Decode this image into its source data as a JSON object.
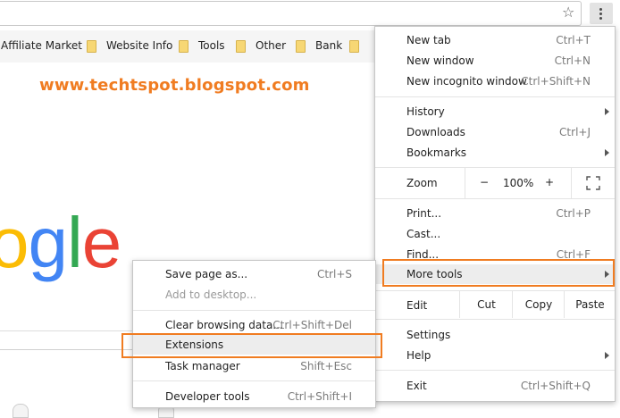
{
  "bookmarks": [
    {
      "label": "Affiliate Market"
    },
    {
      "label": "Website Info"
    },
    {
      "label": "Tools"
    },
    {
      "label": "Other"
    },
    {
      "label": "Bank"
    }
  ],
  "page": {
    "site_url": "www.techtspot.blogspot.com",
    "logo_letters": [
      "o",
      "g",
      "l",
      "e"
    ]
  },
  "main_menu": {
    "new_tab": {
      "label": "New tab",
      "shortcut": "Ctrl+T"
    },
    "new_window": {
      "label": "New window",
      "shortcut": "Ctrl+N"
    },
    "new_incognito": {
      "label": "New incognito window",
      "shortcut": "Ctrl+Shift+N"
    },
    "history": {
      "label": "History"
    },
    "downloads": {
      "label": "Downloads",
      "shortcut": "Ctrl+J"
    },
    "bookmarks": {
      "label": "Bookmarks"
    },
    "zoom": {
      "label": "Zoom",
      "minus": "−",
      "level": "100%",
      "plus": "+"
    },
    "print": {
      "label": "Print...",
      "shortcut": "Ctrl+P"
    },
    "cast": {
      "label": "Cast..."
    },
    "find": {
      "label": "Find...",
      "shortcut": "Ctrl+F"
    },
    "more_tools": {
      "label": "More tools"
    },
    "edit": {
      "label": "Edit",
      "cut": "Cut",
      "copy": "Copy",
      "paste": "Paste"
    },
    "settings": {
      "label": "Settings"
    },
    "help": {
      "label": "Help"
    },
    "exit": {
      "label": "Exit",
      "shortcut": "Ctrl+Shift+Q"
    }
  },
  "submenu": {
    "save_page": {
      "label": "Save page as...",
      "shortcut": "Ctrl+S"
    },
    "add_desktop": {
      "label": "Add to desktop..."
    },
    "clear_browsing": {
      "label": "Clear browsing data...",
      "shortcut": "Ctrl+Shift+Del"
    },
    "extensions": {
      "label": "Extensions"
    },
    "task_manager": {
      "label": "Task manager",
      "shortcut": "Shift+Esc"
    },
    "dev_tools": {
      "label": "Developer tools",
      "shortcut": "Ctrl+Shift+I"
    }
  },
  "colors": {
    "highlight": "#f07c21",
    "logo": [
      "#fbbc05",
      "#4285f4",
      "#34a853",
      "#ea4335"
    ]
  },
  "icons": {
    "star": "star-icon",
    "menu": "three-dots-menu-icon",
    "fullscreen": "fullscreen-icon",
    "folder": "folder-icon"
  }
}
